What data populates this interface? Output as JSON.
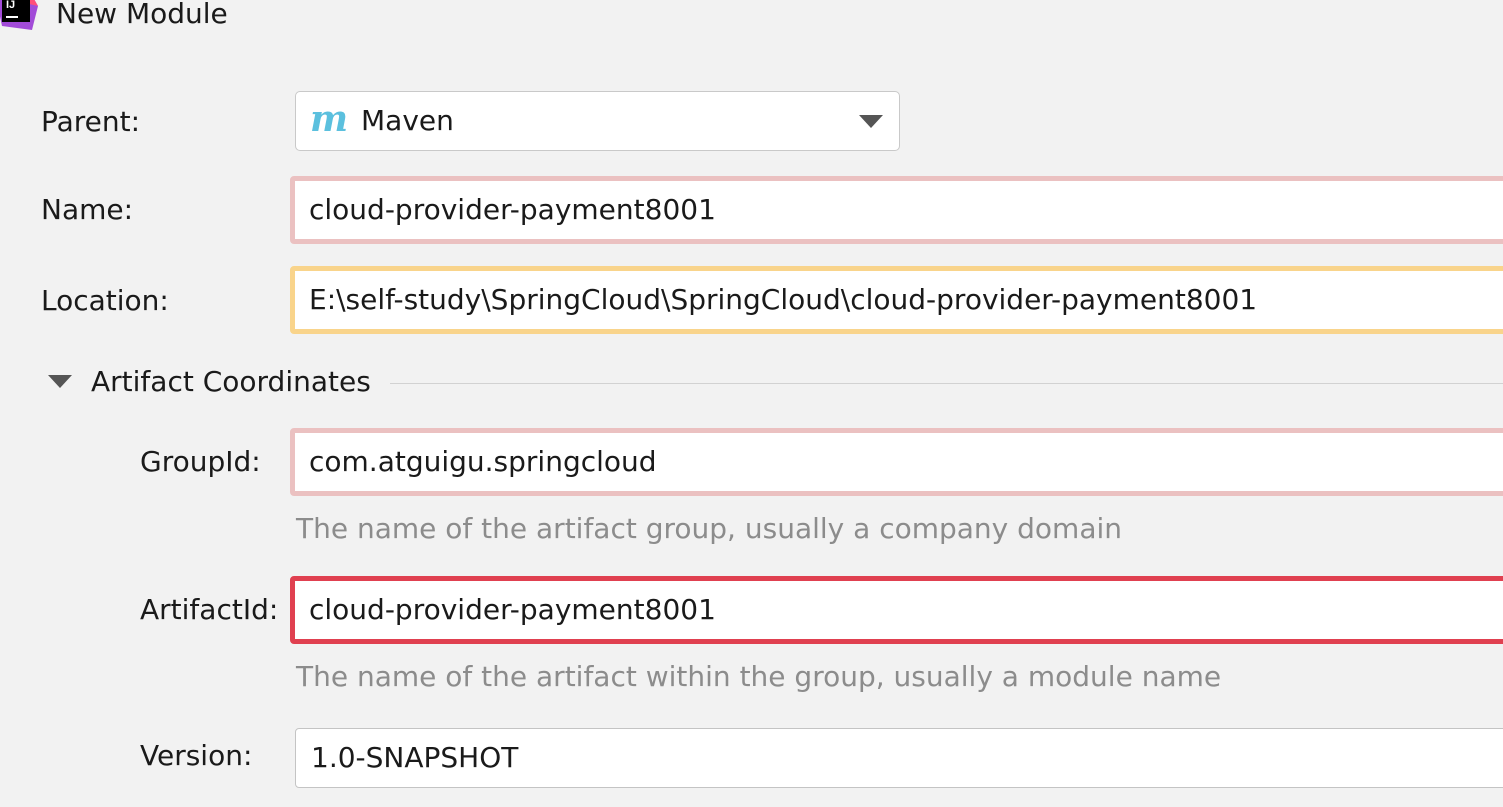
{
  "window": {
    "title": "New Module",
    "icon": "intellij-idea-icon"
  },
  "form": {
    "parent": {
      "label": "Parent:",
      "value": "Maven",
      "icon": "maven-icon"
    },
    "name": {
      "label": "Name:",
      "value": "cloud-provider-payment8001",
      "status": "invalid"
    },
    "location": {
      "label": "Location:",
      "value": "E:\\self-study\\SpringCloud\\SpringCloud\\cloud-provider-payment8001",
      "status": "warning"
    }
  },
  "artifact_coordinates": {
    "title": "Artifact Coordinates",
    "expanded": true,
    "group_id": {
      "label": "GroupId:",
      "value": "com.atguigu.springcloud",
      "hint": "The name of the artifact group, usually a company domain",
      "status": "invalid"
    },
    "artifact_id": {
      "label": "ArtifactId:",
      "value": "cloud-provider-payment8001",
      "hint": "The name of the artifact within the group, usually a module name",
      "status": "error-focused"
    },
    "version": {
      "label": "Version:",
      "value": "1.0-SNAPSHOT"
    }
  },
  "colors": {
    "background": "#f2f2f2",
    "invalid_border": "#ebc1c1",
    "warning_border": "#f9d48b",
    "error_border": "#e04050",
    "hint_text": "#8c8c8c",
    "maven_icon": "#5bc0de"
  }
}
